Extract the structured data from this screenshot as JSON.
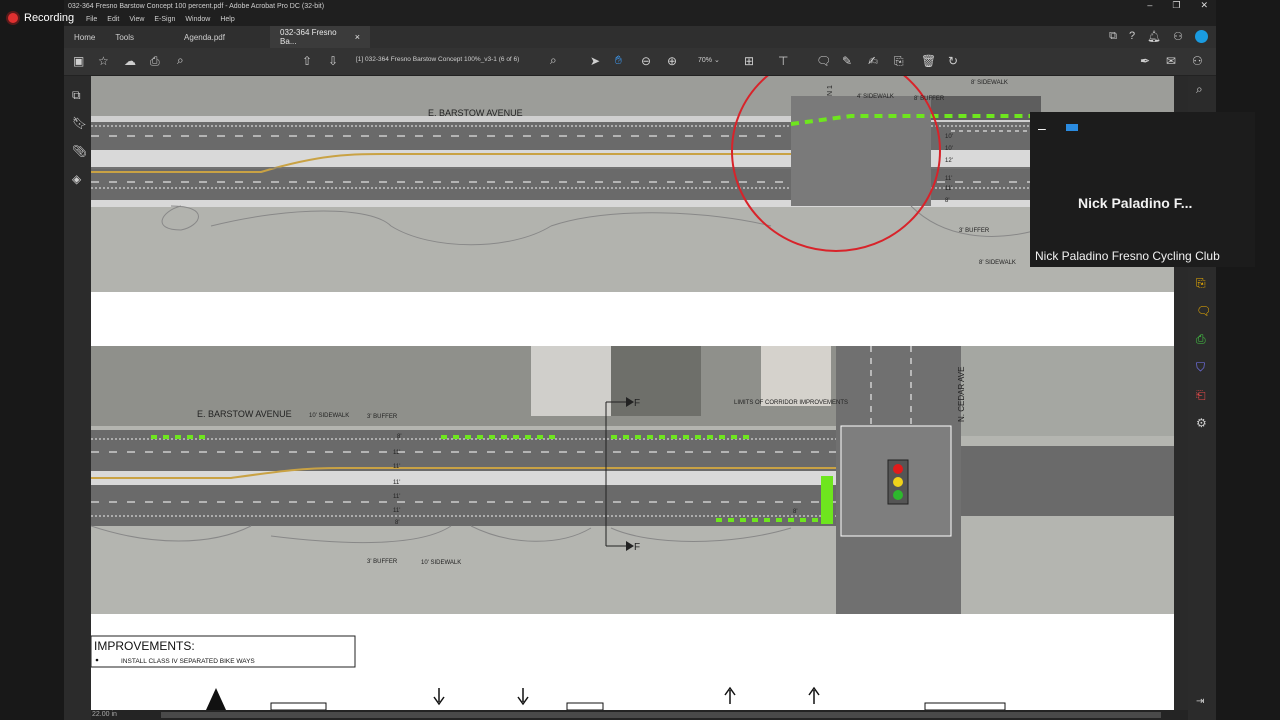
{
  "recording": {
    "label": "Recording"
  },
  "window": {
    "title": "032-364 Fresno Barstow Concept 100 percent.pdf - Adobe Acrobat Pro DC (32-bit)",
    "controls": [
      "–",
      "❐",
      "✕"
    ]
  },
  "menu": [
    "File",
    "Edit",
    "View",
    "E-Sign",
    "Window",
    "Help"
  ],
  "tabs": [
    {
      "label": "Home"
    },
    {
      "label": "Tools"
    },
    {
      "label": "Agenda.pdf"
    },
    {
      "label": "032-364 Fresno Ba...",
      "active": true
    }
  ],
  "toolbar": {
    "page_field": "[1] 032-364 Fresno Barstow Concept 100%_v3-1",
    "page_count": "(6 of 6)",
    "zoom": "70%"
  },
  "status": {
    "scale": "22.00 in"
  },
  "plan": {
    "top_street": "E. BARSTOW AVENUE",
    "top_sidewalk": "8' SIDEWALK",
    "top_sidewalk_2": "4' SIDEWALK",
    "top_buffer": "8' BUFFER",
    "bottom_buffer_top": "3' BUFFER",
    "bottom_sidewalk_top": "8' SIDEWALK",
    "north_label": "N 1",
    "dims_top": [
      "10'",
      "10'",
      "12'",
      "11'",
      "11'",
      "8'"
    ],
    "bottom_street": "E. BARSTOW AVENUE",
    "sidewalk_label": "10' SIDEWALK",
    "buffer_label": "3' BUFFER",
    "dims_bottom": [
      "8'",
      "11'",
      "11'",
      "11'",
      "11'",
      "11'",
      "8'"
    ],
    "dim_8": "8'",
    "section_label_top": "F",
    "section_label_bottom": "F",
    "limits_note": "LIMITS OF CORRIDOR IMPROVEMENTS",
    "cross_street": "N. CEDAR AVE",
    "buffer_bottom": "3' BUFFER",
    "sidewalk_bottom": "10' SIDEWALK"
  },
  "improvements": {
    "title": "IMPROVEMENTS:",
    "items": [
      "INSTALL CLASS IV SEPARATED BIKE WAYS"
    ]
  },
  "video": {
    "tile_name": "Nick Paladino   F...",
    "caption": "Nick Paladino  Fresno Cycling Club"
  },
  "colors": {
    "bike_lane_green": "#6ee61e",
    "redline": "#d8232a",
    "avatar_blue": "#1a9be0"
  }
}
